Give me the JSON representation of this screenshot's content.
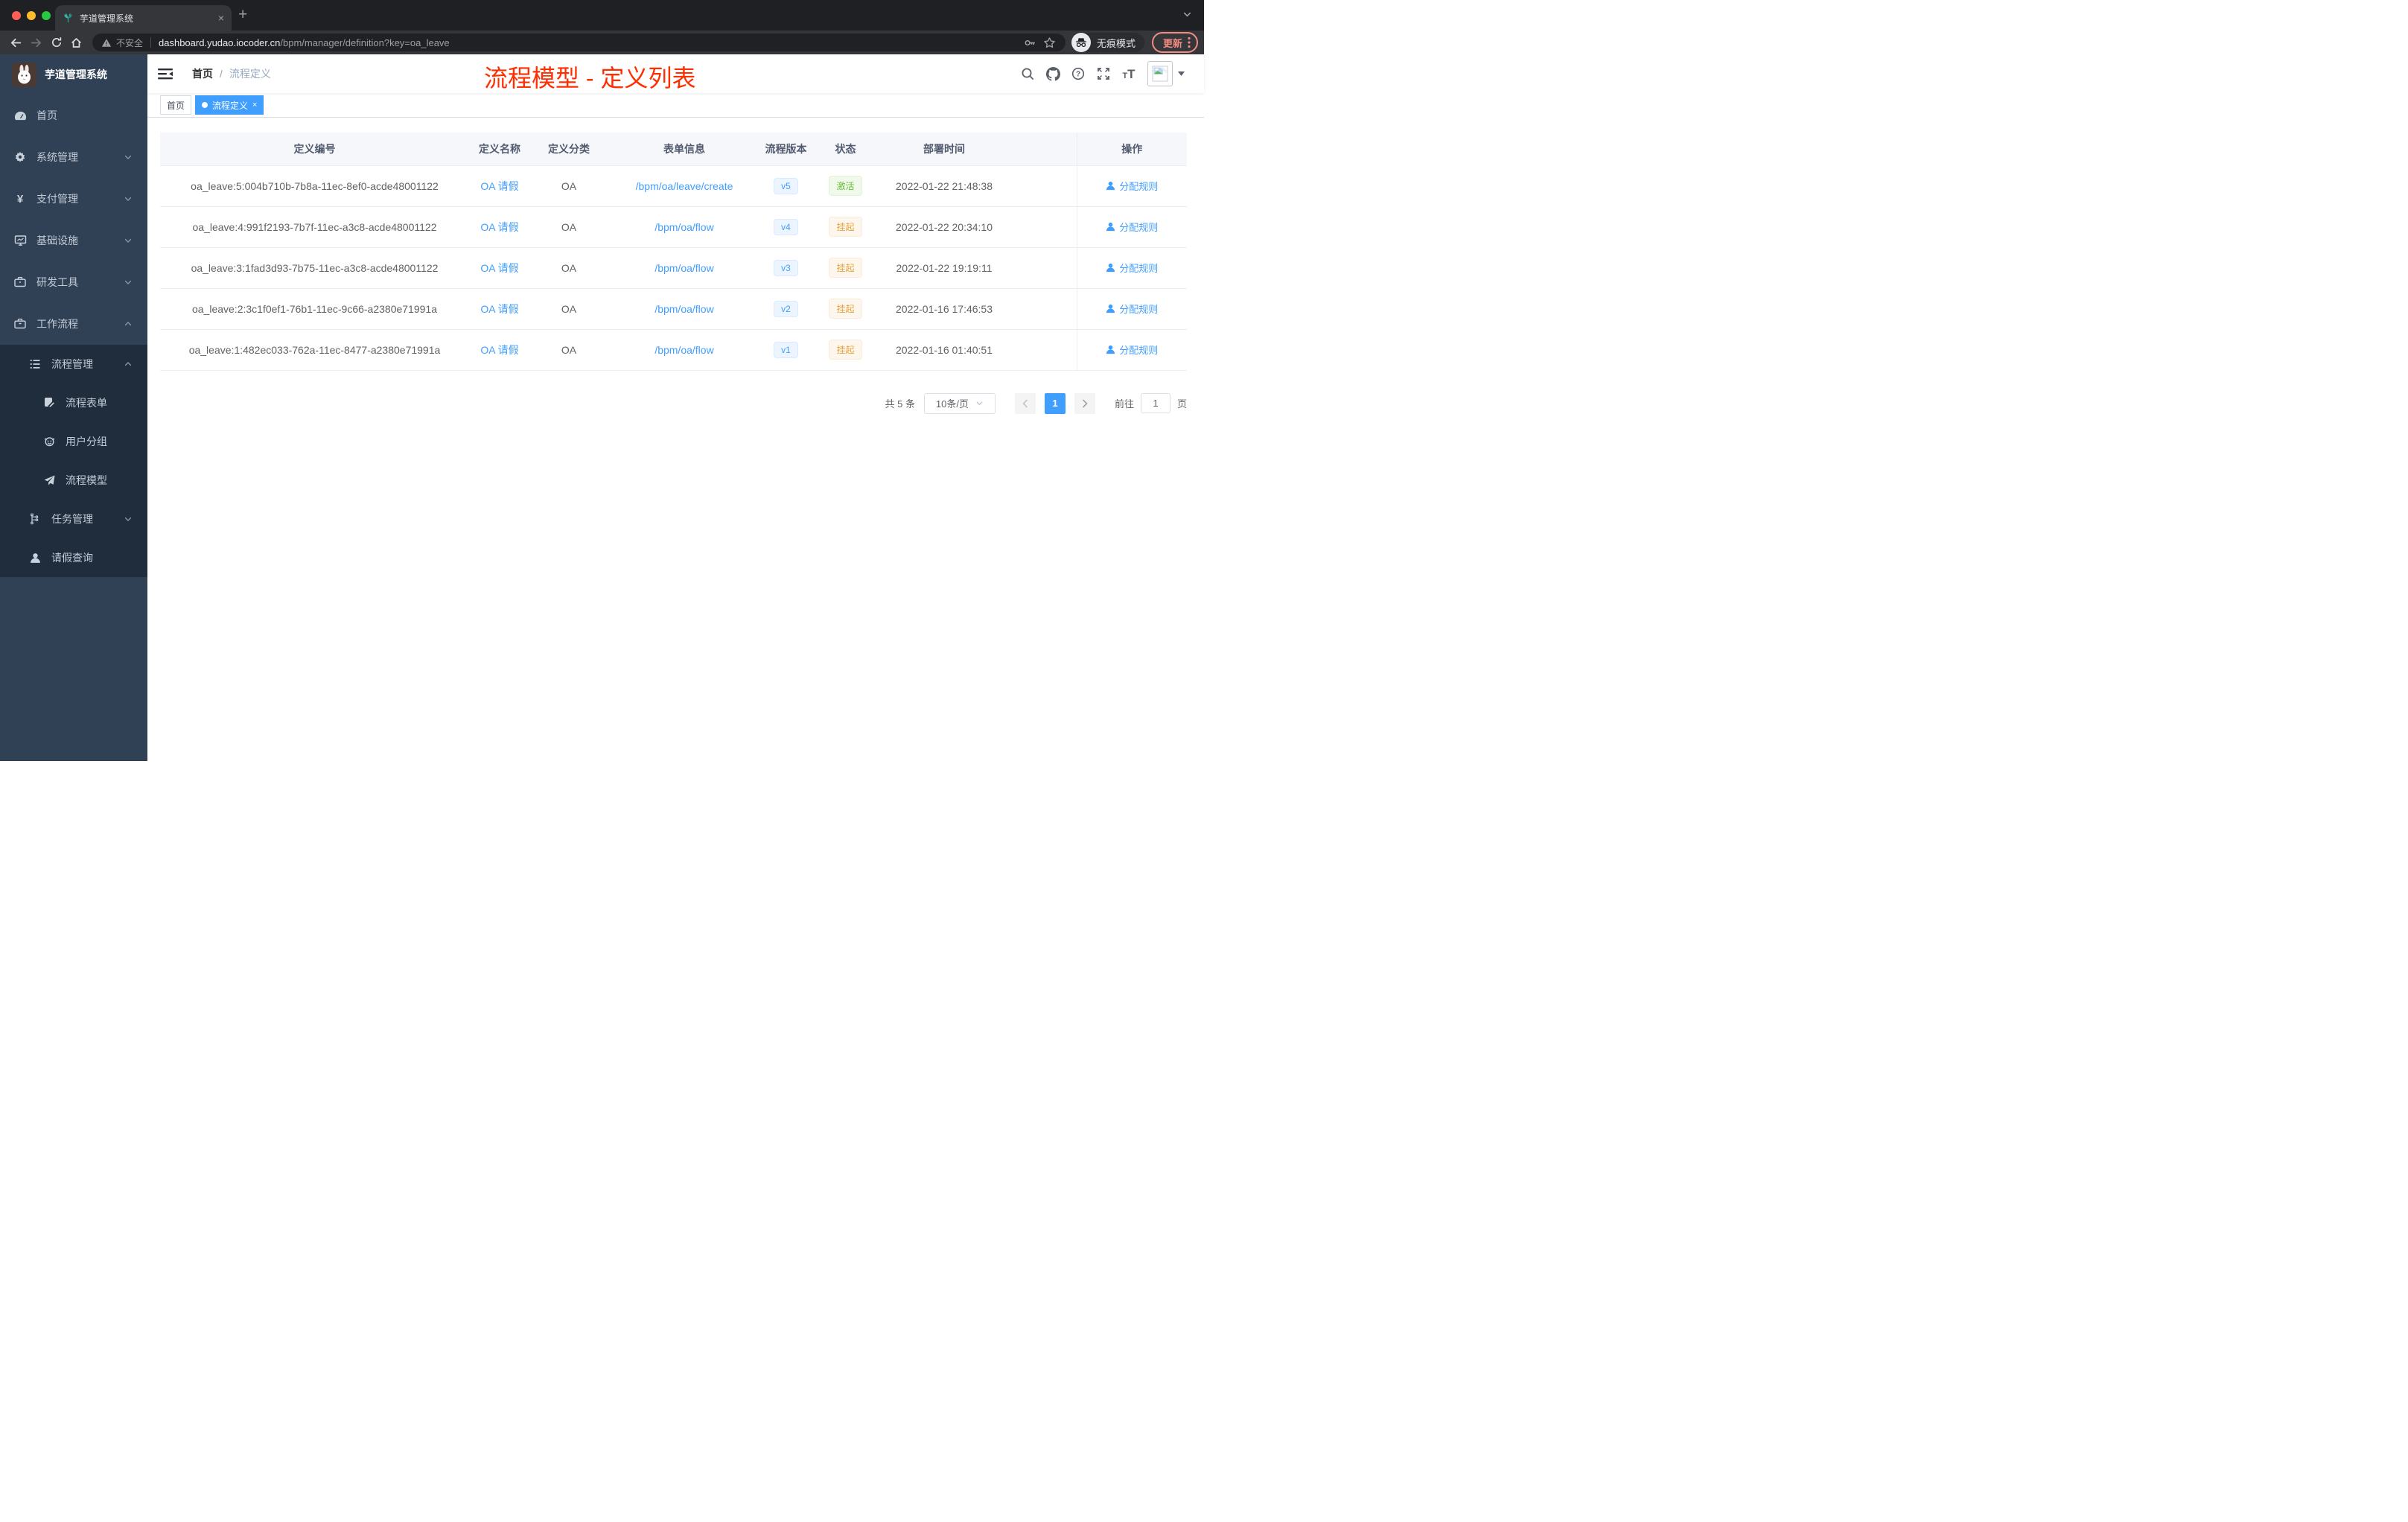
{
  "colors": {
    "accent": "#409eff",
    "sidebar_bg": "#304156",
    "submenu_bg": "#1f2d3d",
    "annotation_red": "#ff2e00",
    "status_active_green": "#67c23a",
    "status_suspend_orange": "#e6a23c",
    "update_button_coral": "#f28b82"
  },
  "icons": {
    "new_tab_plus": "+",
    "tab_close": "×",
    "tag_close": "×",
    "help_glyph": "?",
    "font_small": "T",
    "font_large": "T",
    "currency": "¥"
  },
  "browser": {
    "tab_title": "芋道管理系统",
    "security_label": "不安全",
    "url_domain": "dashboard.yudao.iocoder.cn",
    "url_path": "/bpm/manager/definition?key=oa_leave",
    "incognito_label": "无痕模式",
    "update_label": "更新"
  },
  "sidebar": {
    "title": "芋道管理系统",
    "menu": [
      {
        "label": "首页",
        "icon": "dashboard-icon",
        "expandable": false
      },
      {
        "label": "系统管理",
        "icon": "gear-icon",
        "expandable": true,
        "expanded": false
      },
      {
        "label": "支付管理",
        "icon": "yen-icon",
        "expandable": true,
        "expanded": false
      },
      {
        "label": "基础设施",
        "icon": "monitor-icon",
        "expandable": true,
        "expanded": false
      },
      {
        "label": "研发工具",
        "icon": "toolbox-icon",
        "expandable": true,
        "expanded": false
      },
      {
        "label": "工作流程",
        "icon": "briefcase-icon",
        "expandable": true,
        "expanded": true
      }
    ],
    "submenu": [
      {
        "label": "流程管理",
        "icon": "list-icon",
        "level": 1,
        "expandable": true,
        "expanded": true
      },
      {
        "label": "流程表单",
        "icon": "form-icon",
        "level": 2
      },
      {
        "label": "用户分组",
        "icon": "group-icon",
        "level": 2
      },
      {
        "label": "流程模型",
        "icon": "paper-plane-icon",
        "level": 2
      },
      {
        "label": "任务管理",
        "icon": "tree-icon",
        "level": 1,
        "expandable": true,
        "expanded": false
      },
      {
        "label": "请假查询",
        "icon": "user-icon",
        "level": 1
      }
    ]
  },
  "navbar": {
    "breadcrumb": {
      "home": "首页",
      "separator": "/",
      "current": "流程定义"
    },
    "annotation": "流程模型 - 定义列表"
  },
  "tags": {
    "inactive": "首页",
    "active": "流程定义"
  },
  "table": {
    "headers": [
      "定义编号",
      "定义名称",
      "定义分类",
      "表单信息",
      "流程版本",
      "状态",
      "部署时间",
      "操作"
    ],
    "rows": [
      {
        "id": "oa_leave:5:004b710b-7b8a-11ec-8ef0-acde48001122",
        "name": "OA 请假",
        "category": "OA",
        "form": "/bpm/oa/leave/create",
        "version": "v5",
        "status": "激活",
        "status_type": "success",
        "deployed": "2022-01-22 21:48:38",
        "action": "分配规则"
      },
      {
        "id": "oa_leave:4:991f2193-7b7f-11ec-a3c8-acde48001122",
        "name": "OA 请假",
        "category": "OA",
        "form": "/bpm/oa/flow",
        "version": "v4",
        "status": "挂起",
        "status_type": "warning",
        "deployed": "2022-01-22 20:34:10",
        "action": "分配规则"
      },
      {
        "id": "oa_leave:3:1fad3d93-7b75-11ec-a3c8-acde48001122",
        "name": "OA 请假",
        "category": "OA",
        "form": "/bpm/oa/flow",
        "version": "v3",
        "status": "挂起",
        "status_type": "warning",
        "deployed": "2022-01-22 19:19:11",
        "action": "分配规则"
      },
      {
        "id": "oa_leave:2:3c1f0ef1-76b1-11ec-9c66-a2380e71991a",
        "name": "OA 请假",
        "category": "OA",
        "form": "/bpm/oa/flow",
        "version": "v2",
        "status": "挂起",
        "status_type": "warning",
        "deployed": "2022-01-16 17:46:53",
        "action": "分配规则"
      },
      {
        "id": "oa_leave:1:482ec033-762a-11ec-8477-a2380e71991a",
        "name": "OA 请假",
        "category": "OA",
        "form": "/bpm/oa/flow",
        "version": "v1",
        "status": "挂起",
        "status_type": "warning",
        "deployed": "2022-01-16 01:40:51",
        "action": "分配规则"
      }
    ]
  },
  "pagination": {
    "total": "共 5 条",
    "page_size": "10条/页",
    "page": "1",
    "goto_label": "前往",
    "goto_value": "1",
    "goto_unit": "页"
  }
}
